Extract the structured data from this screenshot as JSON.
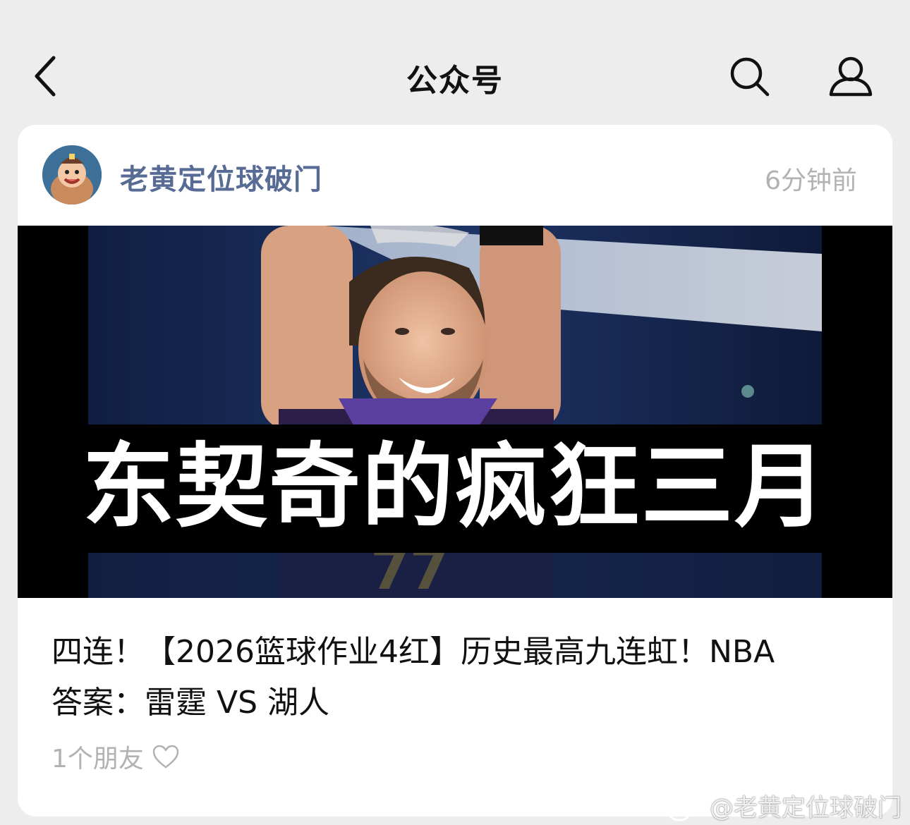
{
  "header": {
    "title": "公众号",
    "back_icon": "chevron-left-icon",
    "search_icon": "search-icon",
    "profile_icon": "person-icon"
  },
  "card": {
    "account_name": "老黄定位球破门",
    "timestamp": "6分钟前",
    "cover_caption": "东契奇的疯狂三月",
    "title_line1": "四连！【2026篮球作业4红】历史最高九连虹！NBA",
    "title_line2": "答案：雷霆 VS 湖人",
    "friends_text": "1个朋友",
    "friends_icon": "heart-outline-icon"
  },
  "watermark": {
    "text": "@老黄定位球破门",
    "icon": "weibo-logo-icon"
  },
  "colors": {
    "background": "#ededed",
    "account_name": "#576b95",
    "muted_text": "#b2b2b2"
  }
}
